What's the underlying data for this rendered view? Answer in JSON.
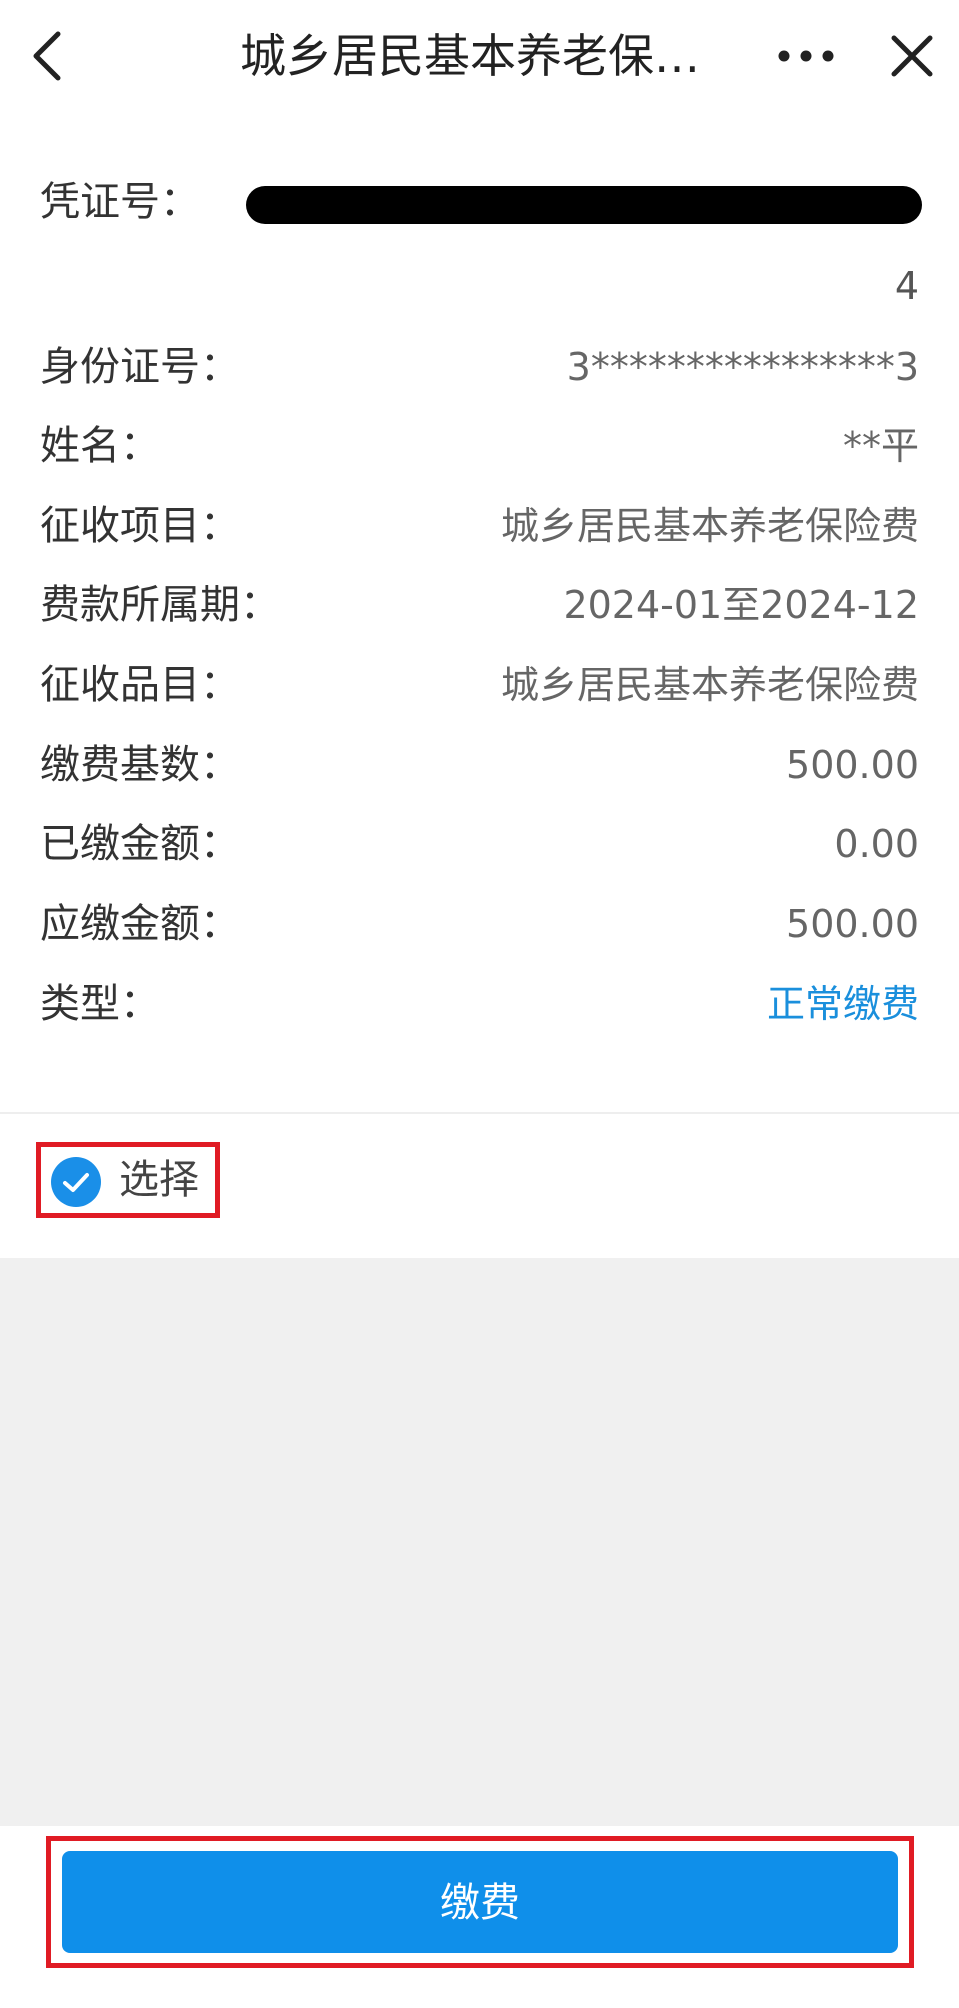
{
  "nav": {
    "title": "城乡居民基本养老保…"
  },
  "voucher": {
    "label": "凭证号：",
    "suffix": "4"
  },
  "fields": [
    {
      "label": "身份证号：",
      "value": "3****************3"
    },
    {
      "label": "姓名：",
      "value": "**平"
    },
    {
      "label": "征收项目：",
      "value": "城乡居民基本养老保险费"
    },
    {
      "label": "费款所属期：",
      "value": "2024-01至2024-12"
    },
    {
      "label": "征收品目：",
      "value": "城乡居民基本养老保险费"
    },
    {
      "label": "缴费基数：",
      "value": "500.00"
    },
    {
      "label": "已缴金额：",
      "value": "0.00"
    },
    {
      "label": "应缴金额：",
      "value": "500.00"
    },
    {
      "label": "类型：",
      "value": "正常缴费"
    }
  ],
  "select": {
    "label": "选择",
    "checked": true
  },
  "pay_button": {
    "label": "缴费"
  },
  "colors": {
    "accent": "#0f8fea",
    "type_value": "#1a8fdc",
    "highlight_border": "#e01b24"
  }
}
